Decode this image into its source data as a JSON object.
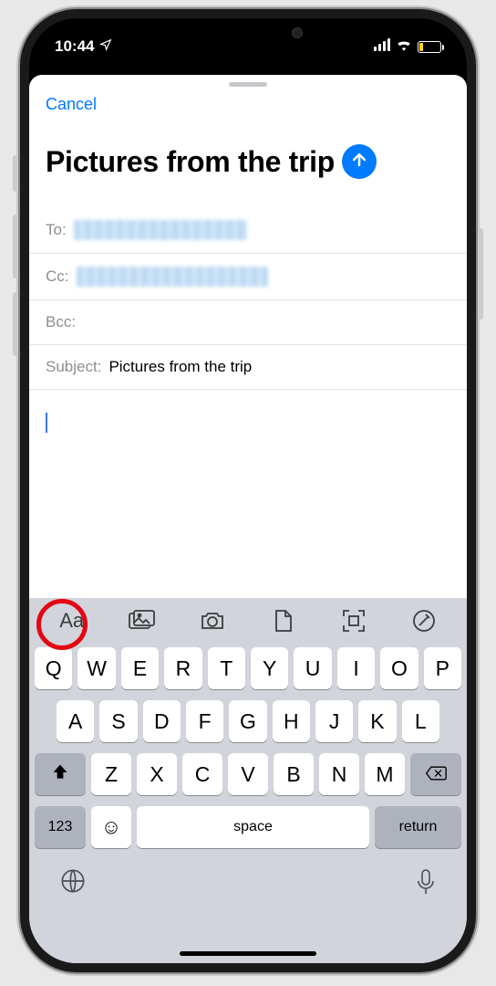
{
  "status": {
    "time": "10:44",
    "location_icon": "location-arrow-icon",
    "cellular_icon": "cellular-icon",
    "wifi_icon": "wifi-icon",
    "battery_low": true
  },
  "sheet": {
    "cancel": "Cancel",
    "title": "Pictures from the trip",
    "send_icon": "arrow-up-icon"
  },
  "fields": {
    "to_label": "To:",
    "cc_label": "Cc:",
    "bcc_label": "Bcc:",
    "subject_label": "Subject:",
    "subject_value": "Pictures from the trip"
  },
  "toolbar": {
    "format_icon": "text-format-icon",
    "format_label": "Aa",
    "photos_icon": "photos-icon",
    "camera_icon": "camera-icon",
    "document_icon": "document-icon",
    "scan_icon": "scan-icon",
    "markup_icon": "markup-icon"
  },
  "keyboard": {
    "row1": [
      "Q",
      "W",
      "E",
      "R",
      "T",
      "Y",
      "U",
      "I",
      "O",
      "P"
    ],
    "row2": [
      "A",
      "S",
      "D",
      "F",
      "G",
      "H",
      "J",
      "K",
      "L"
    ],
    "row3": [
      "Z",
      "X",
      "C",
      "V",
      "B",
      "N",
      "M"
    ],
    "shift_icon": "shift-icon",
    "backspace_icon": "backspace-icon",
    "k123": "123",
    "emoji_icon": "emoji-icon",
    "space": "space",
    "return": "return",
    "globe_icon": "globe-icon",
    "mic_icon": "mic-icon"
  },
  "annotation": {
    "highlight_target": "text-format-icon",
    "highlight_color": "#e30613"
  }
}
